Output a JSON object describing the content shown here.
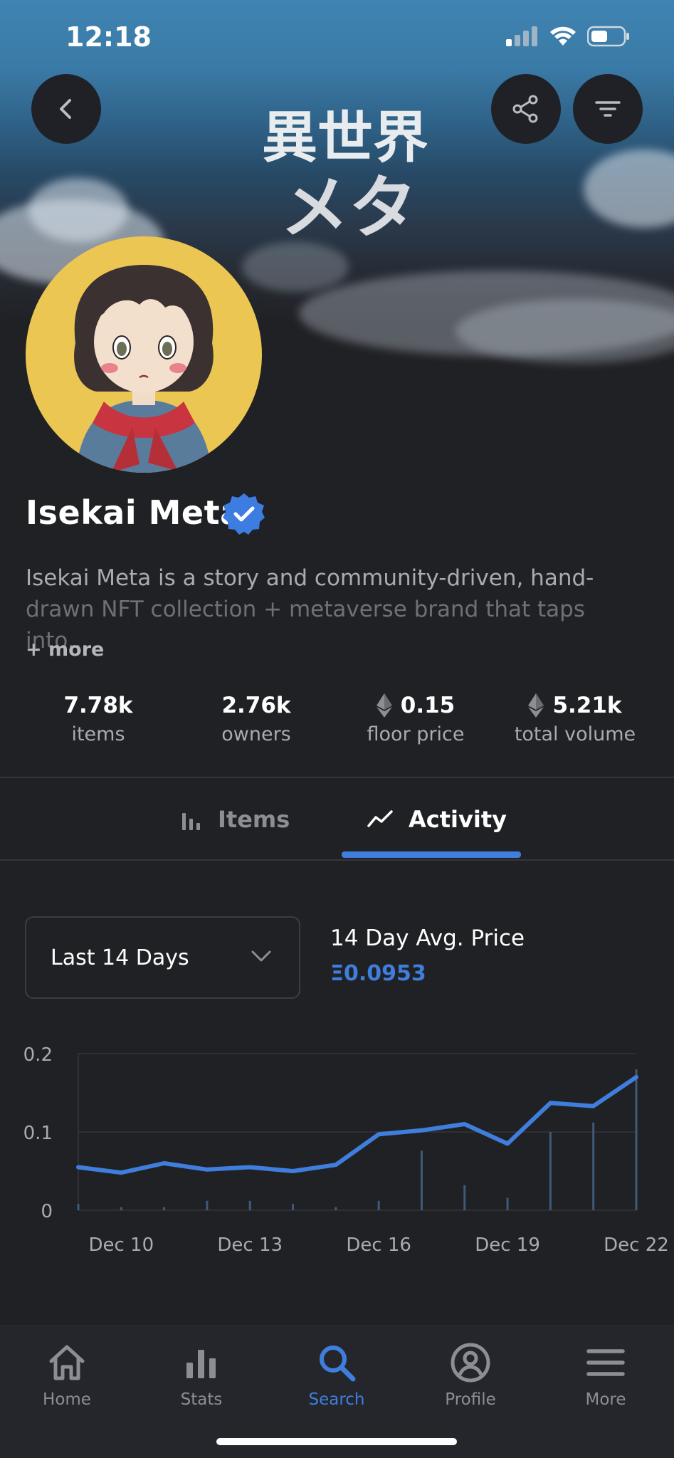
{
  "status_bar": {
    "time": "12:18"
  },
  "banner": {
    "logo_line1": "異世界",
    "logo_line2": "メタ"
  },
  "header": {
    "back_icon": "chevron-left-icon",
    "share_icon": "share-icon",
    "filter_icon": "filter-icon"
  },
  "collection": {
    "name": "Isekai Meta",
    "verified": true,
    "description_line1": "Isekai Meta is a story and community-driven, hand-",
    "description_line2": "drawn NFT collection + metaverse brand that taps into...",
    "more_label": "+ more"
  },
  "stats": [
    {
      "value": "7.78k",
      "label": "items",
      "eth": false
    },
    {
      "value": "2.76k",
      "label": "owners",
      "eth": false
    },
    {
      "value": "0.15",
      "label": "floor price",
      "eth": true
    },
    {
      "value": "5.21k",
      "label": "total volume",
      "eth": true
    }
  ],
  "tabs": [
    {
      "label": "Items",
      "icon": "bar-chart-icon",
      "active": false
    },
    {
      "label": "Activity",
      "icon": "trend-line-icon",
      "active": true
    }
  ],
  "activity": {
    "range_selected": "Last 14 Days",
    "avg_label": "14 Day Avg. Price",
    "avg_value": "Ξ0.0953"
  },
  "chart_data": {
    "type": "line",
    "x": [
      "Dec 9",
      "Dec 10",
      "Dec 11",
      "Dec 12",
      "Dec 13",
      "Dec 14",
      "Dec 15",
      "Dec 16",
      "Dec 17",
      "Dec 18",
      "Dec 19",
      "Dec 20",
      "Dec 21",
      "Dec 22"
    ],
    "xticks": [
      "Dec 10",
      "Dec 13",
      "Dec 16",
      "Dec 19",
      "Dec 22"
    ],
    "yticks": [
      "0",
      "0.1",
      "0.2"
    ],
    "ylim": [
      0,
      0.2
    ],
    "series": [
      {
        "values": [
          0.055,
          0.048,
          0.06,
          0.052,
          0.055,
          0.05,
          0.058,
          0.097,
          0.102,
          0.11,
          0.085,
          0.137,
          0.133,
          0.17
        ]
      }
    ],
    "volume_bars": [
      0.02,
      0.01,
      0.01,
      0.03,
      0.03,
      0.02,
      0.01,
      0.03,
      0.19,
      0.08,
      0.04,
      0.25,
      0.28,
      0.45
    ],
    "grid": true,
    "line_color": "#3f7edc"
  },
  "bottom_nav": [
    {
      "label": "Home",
      "icon": "home-icon",
      "active": false
    },
    {
      "label": "Stats",
      "icon": "stats-icon",
      "active": false
    },
    {
      "label": "Search",
      "icon": "search-icon",
      "active": true
    },
    {
      "label": "Profile",
      "icon": "profile-icon",
      "active": false
    },
    {
      "label": "More",
      "icon": "menu-icon",
      "active": false
    }
  ],
  "colors": {
    "accent": "#3f7edc",
    "background": "#202125",
    "muted": "#a9abb0"
  }
}
